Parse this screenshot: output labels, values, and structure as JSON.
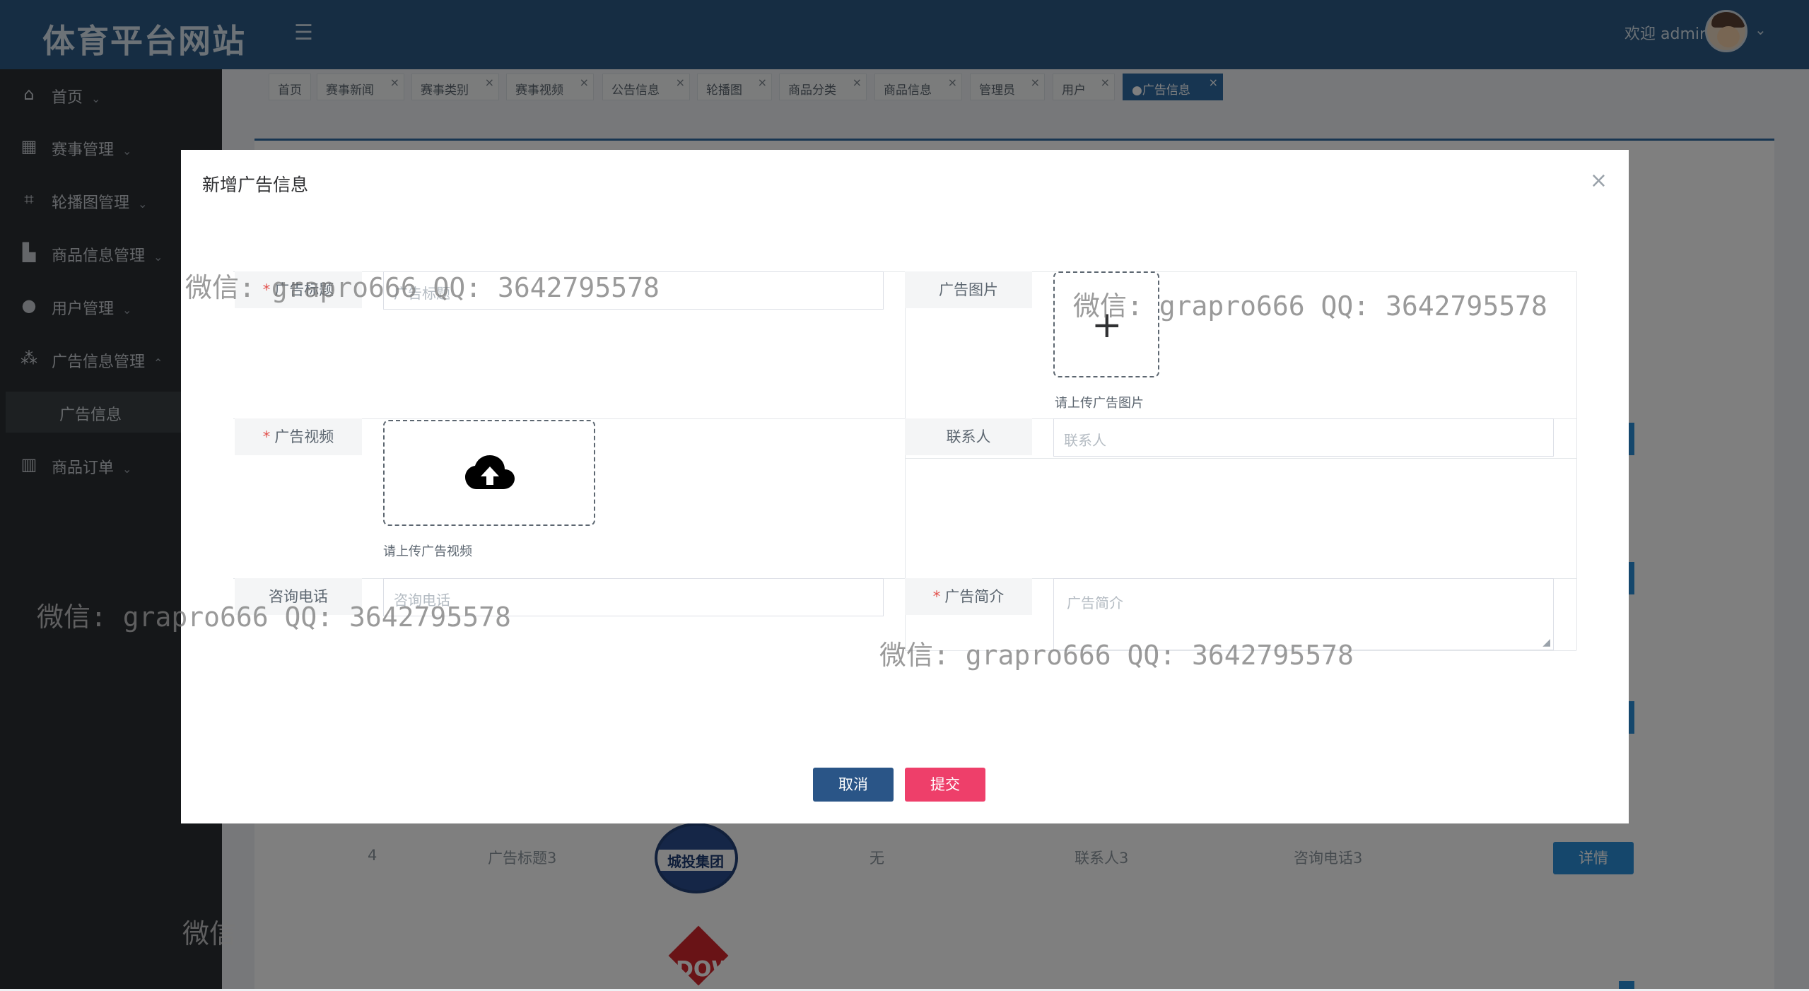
{
  "header": {
    "logo": "体育平台网站",
    "welcome": "欢迎 admin"
  },
  "sidebar": {
    "items": [
      {
        "label": "首页"
      },
      {
        "label": "赛事管理"
      },
      {
        "label": "轮播图管理"
      },
      {
        "label": "商品信息管理"
      },
      {
        "label": "用户管理"
      },
      {
        "label": "广告信息管理"
      },
      {
        "label": "商品订单"
      }
    ],
    "sub_item": "广告信息"
  },
  "tabs": [
    {
      "label": "首页"
    },
    {
      "label": "赛事新闻"
    },
    {
      "label": "赛事类别"
    },
    {
      "label": "赛事视频"
    },
    {
      "label": "公告信息"
    },
    {
      "label": "轮播图"
    },
    {
      "label": "商品分类"
    },
    {
      "label": "商品信息"
    },
    {
      "label": "管理员"
    },
    {
      "label": "用户"
    },
    {
      "label": "●广告信息"
    }
  ],
  "background_row": {
    "index": "4",
    "title": "广告标题3",
    "video": "无",
    "contact": "联系人3",
    "phone": "咨询电话3",
    "detail_button": "详情",
    "logo_text": "城投集团",
    "dow_text": "DOW"
  },
  "modal": {
    "title": "新增广告信息",
    "close": "×",
    "fields": {
      "ad_title": {
        "label": "广告标题",
        "placeholder": "广告标题"
      },
      "ad_image": {
        "label": "广告图片",
        "hint": "请上传广告图片"
      },
      "ad_video": {
        "label": "广告视频",
        "hint": "请上传广告视频"
      },
      "contact": {
        "label": "联系人",
        "placeholder": "联系人"
      },
      "phone": {
        "label": "咨询电话",
        "placeholder": "咨询电话"
      },
      "intro": {
        "label": "广告简介",
        "placeholder": "广告简介"
      }
    },
    "cancel": "取消",
    "submit": "提交"
  },
  "watermark": "微信: grapro666 QQ: 3642795578",
  "watermark_fragment": "微信"
}
